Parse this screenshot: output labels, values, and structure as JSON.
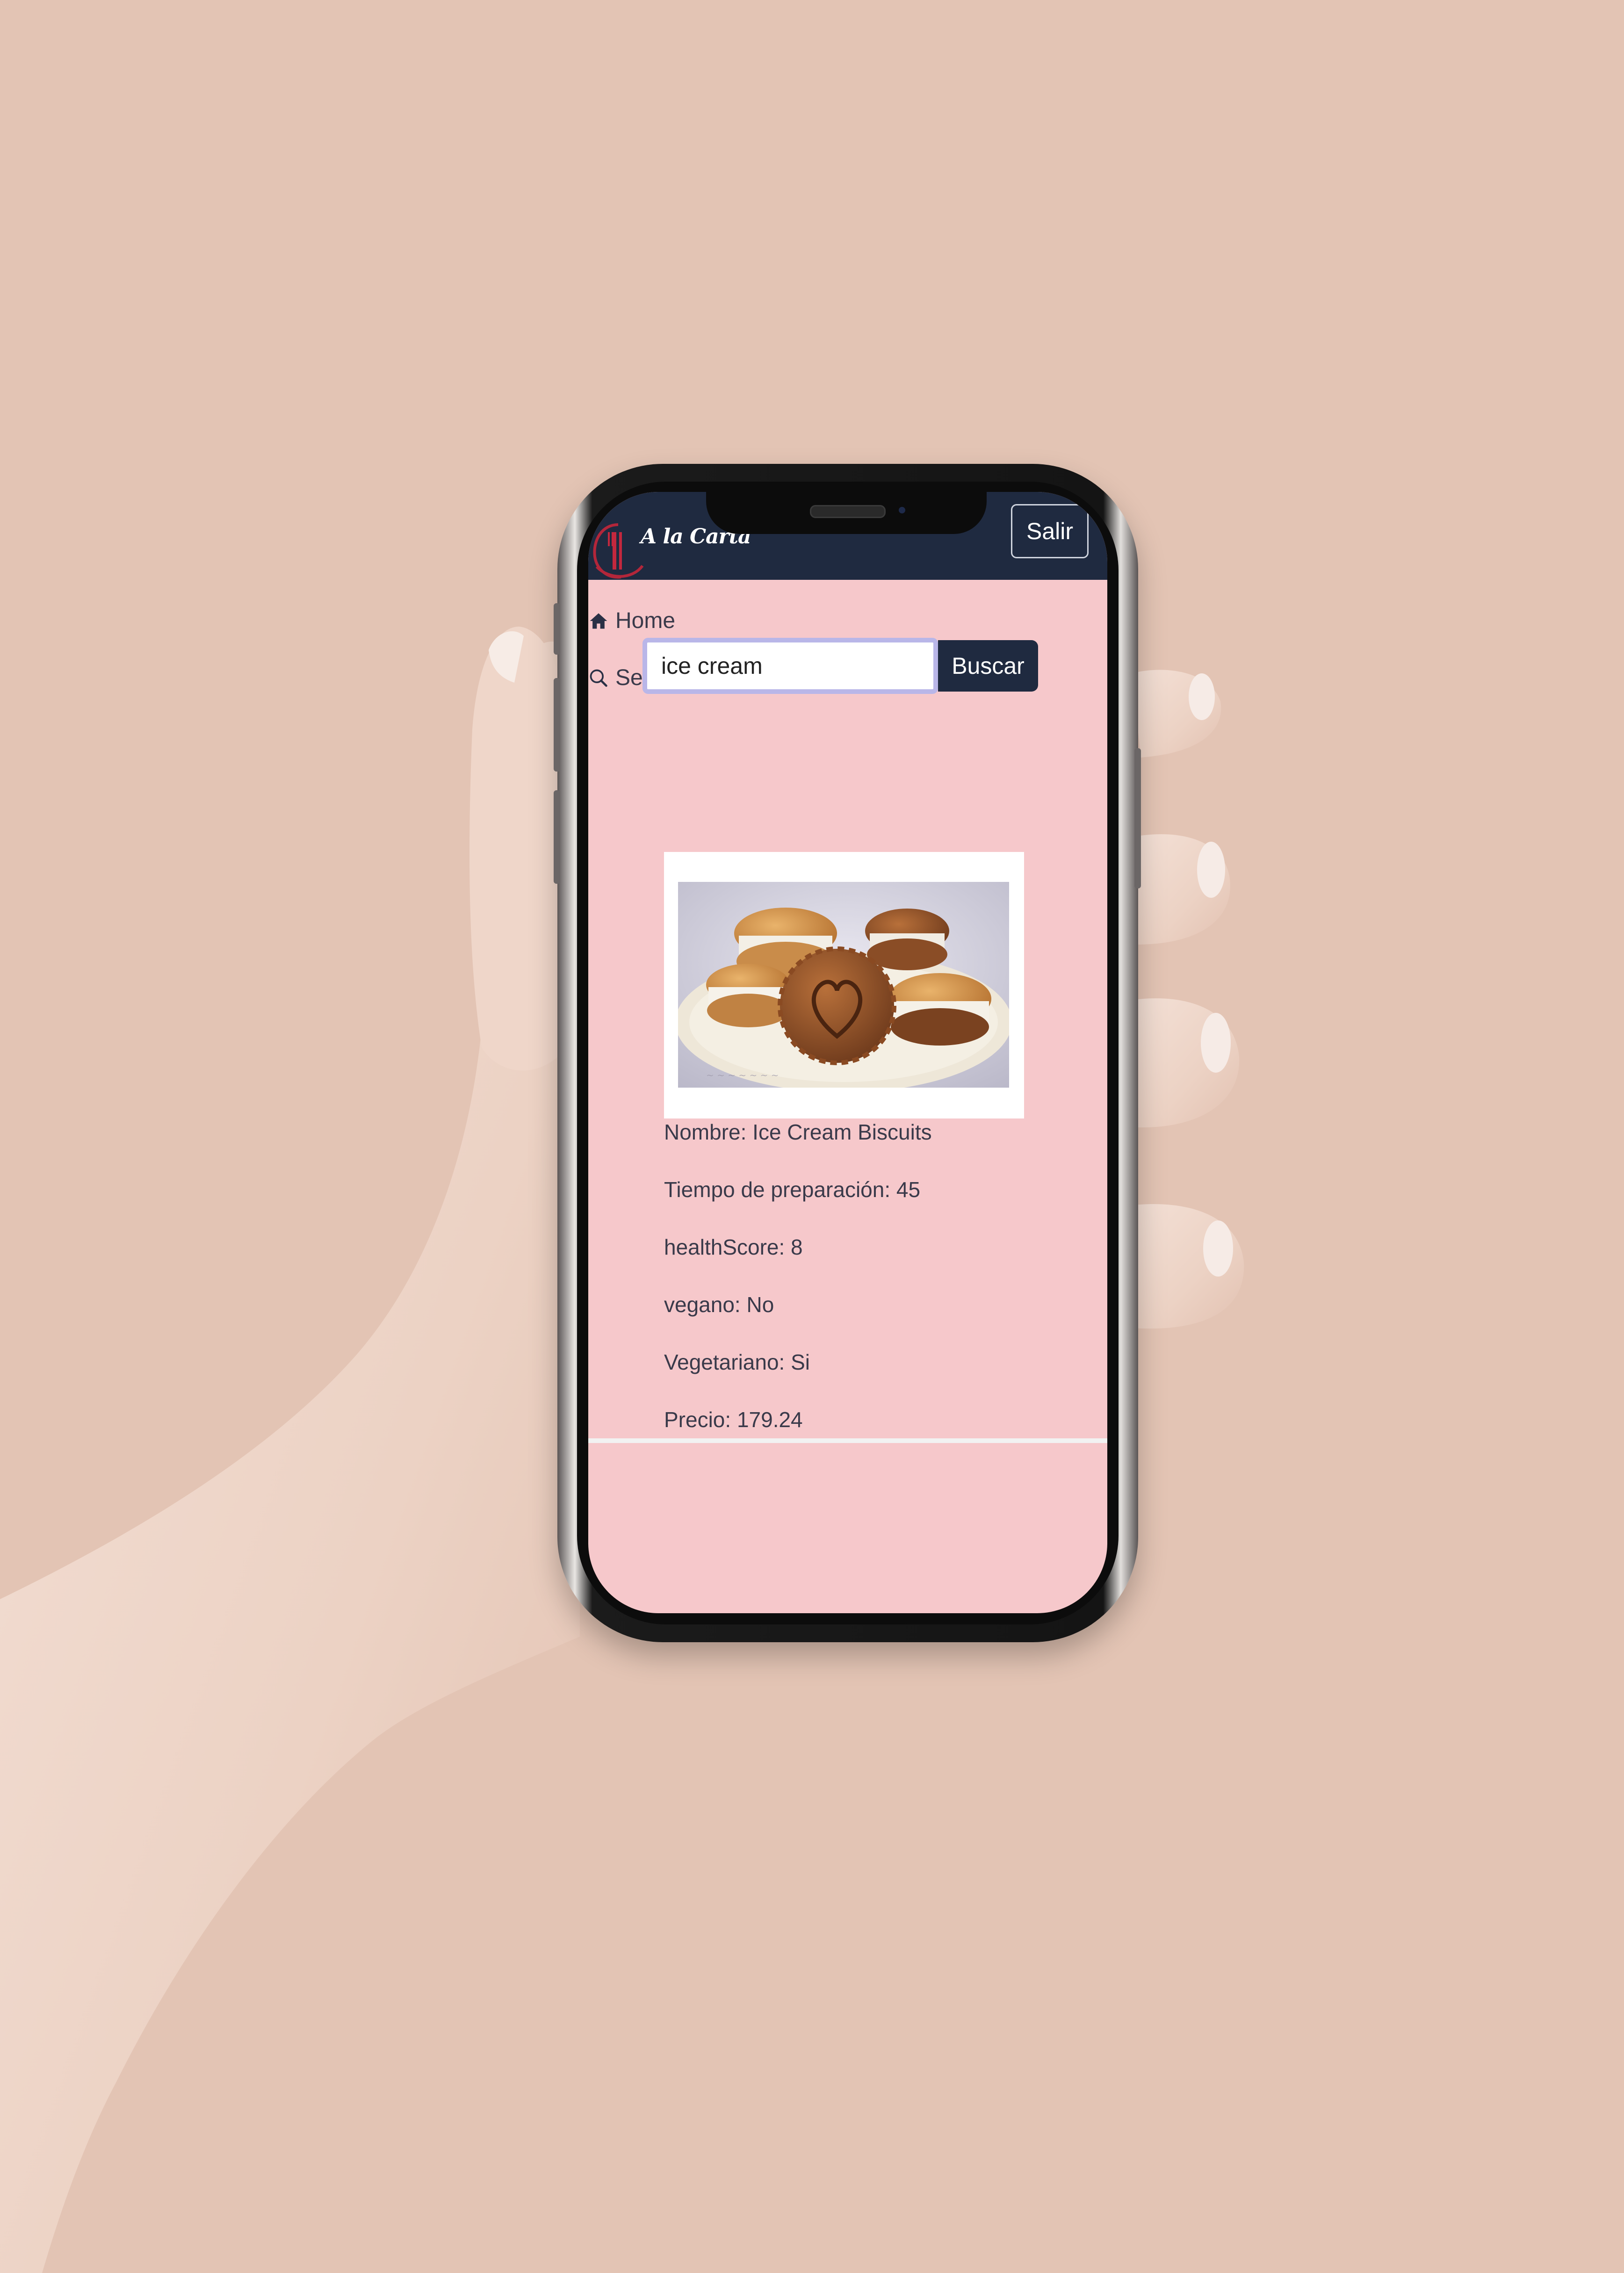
{
  "app": {
    "brand_name": "A la Carta",
    "logo_icon": "restaurant-logo-icon"
  },
  "header": {
    "logout_label": "Salir"
  },
  "nav": {
    "items": [
      {
        "label": "Home",
        "icon": "home-icon"
      },
      {
        "label": "Search",
        "icon": "search-icon"
      }
    ]
  },
  "search": {
    "value": "ice cream",
    "button_label": "Buscar"
  },
  "recipe": {
    "name": "Nombre: Ice Cream Biscuits",
    "prep_time": "Tiempo de preparación: 45",
    "health_score": "healthScore: 8",
    "vegan": "vegano: No",
    "vegetarian": "Vegetariano: Si",
    "price": "Precio: 179.24"
  },
  "colors": {
    "background": "#e3c4b4",
    "screen_bg": "#f6c8cb",
    "navbar": "#1f2a40"
  }
}
